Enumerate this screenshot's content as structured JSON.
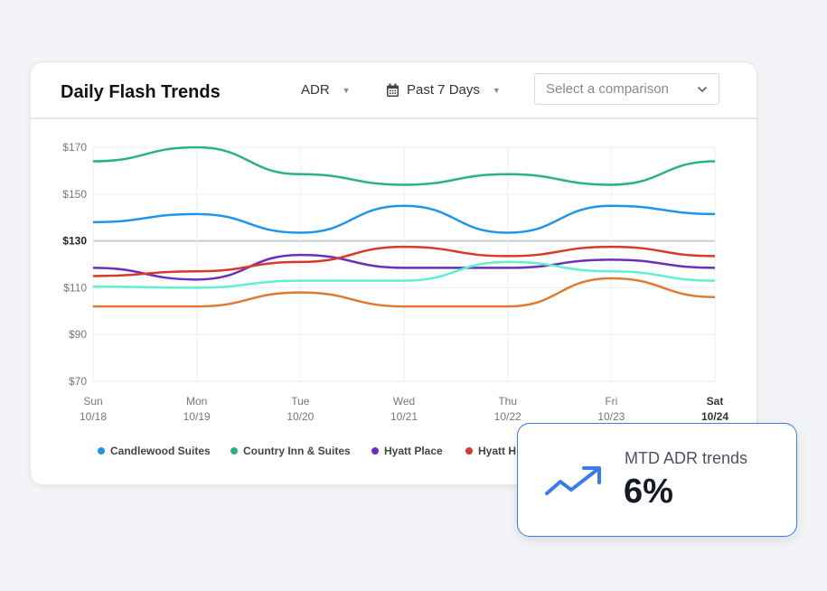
{
  "header": {
    "title": "Daily Flash Trends",
    "metric": "ADR",
    "range": "Past 7 Days",
    "comparison_placeholder": "Select a comparison",
    "calendar_icon": "calendar-icon",
    "caret_icon": "chevron-down-icon"
  },
  "kpi": {
    "label": "MTD ADR trends",
    "value": "6%",
    "icon": "trending-up-icon",
    "accent": "#3b7de8"
  },
  "chart_data": {
    "type": "line",
    "categories": [
      [
        "Sun",
        "10/18"
      ],
      [
        "Mon",
        "10/19"
      ],
      [
        "Tue",
        "10/20"
      ],
      [
        "Wed",
        "10/21"
      ],
      [
        "Thu",
        "10/22"
      ],
      [
        "Fri",
        "10/23"
      ],
      [
        "Sat",
        "10/24"
      ]
    ],
    "yticks": [
      "$70",
      "$90",
      "$110",
      "$130",
      "$150",
      "$170"
    ],
    "ylim": [
      70,
      170
    ],
    "highlight_y": 130,
    "grid": true,
    "legend_position": "bottom",
    "series": [
      {
        "name": "Candlewood Suites",
        "color": "#1e96e8",
        "values": [
          138,
          141.5,
          133.5,
          145,
          133.5,
          145,
          141.5
        ]
      },
      {
        "name": "Country Inn & Suites",
        "color": "#2bb08c",
        "values": [
          164,
          170,
          158.5,
          154,
          158.5,
          154,
          164
        ]
      },
      {
        "name": "Hyatt Place",
        "color": "#6a2fc0",
        "values": [
          118.5,
          113.5,
          124,
          118.5,
          118.5,
          122,
          118.5
        ]
      },
      {
        "name": "Hyatt H",
        "color": "#d83a2a",
        "values": [
          115,
          117,
          121,
          127.5,
          123.5,
          127.5,
          123.5
        ]
      },
      {
        "color": "#5ef0d0",
        "values": [
          110.5,
          110,
          113,
          113,
          121,
          117,
          113
        ]
      },
      {
        "color": "#e07a30",
        "values": [
          102,
          102,
          108,
          102,
          102,
          114,
          106
        ]
      }
    ]
  }
}
